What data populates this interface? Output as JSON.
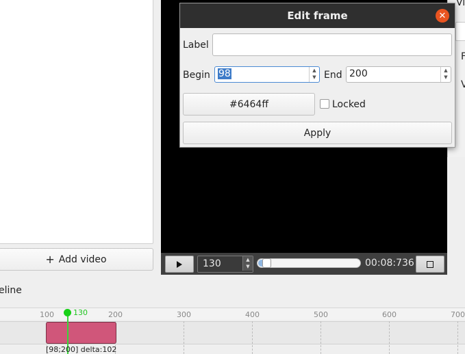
{
  "left_panel": {
    "add_video_label": "Add video"
  },
  "right_panel": {
    "cut_texts": [
      "Vi",
      "F",
      "V"
    ]
  },
  "player": {
    "frame_value": "130",
    "time": "00:08:736",
    "progress": 0.05
  },
  "dialog": {
    "title": "Edit frame",
    "label_caption": "Label",
    "label_value": "",
    "begin_caption": "Begin",
    "begin_value": "98",
    "end_caption": "End",
    "end_value": "200",
    "color_button": "#6464ff",
    "locked_label": "Locked",
    "locked": false,
    "apply_label": "Apply"
  },
  "timeline": {
    "label": "eline",
    "ticks": [
      "100",
      "200",
      "300",
      "400",
      "500",
      "600",
      "700"
    ],
    "playhead": "130",
    "clip_caption": "[98;200] delta:102",
    "clip_color": "#d0567a"
  },
  "colors": {
    "accent": "#e95420",
    "playhead": "#17d117",
    "selection": "#3d7bc8"
  }
}
